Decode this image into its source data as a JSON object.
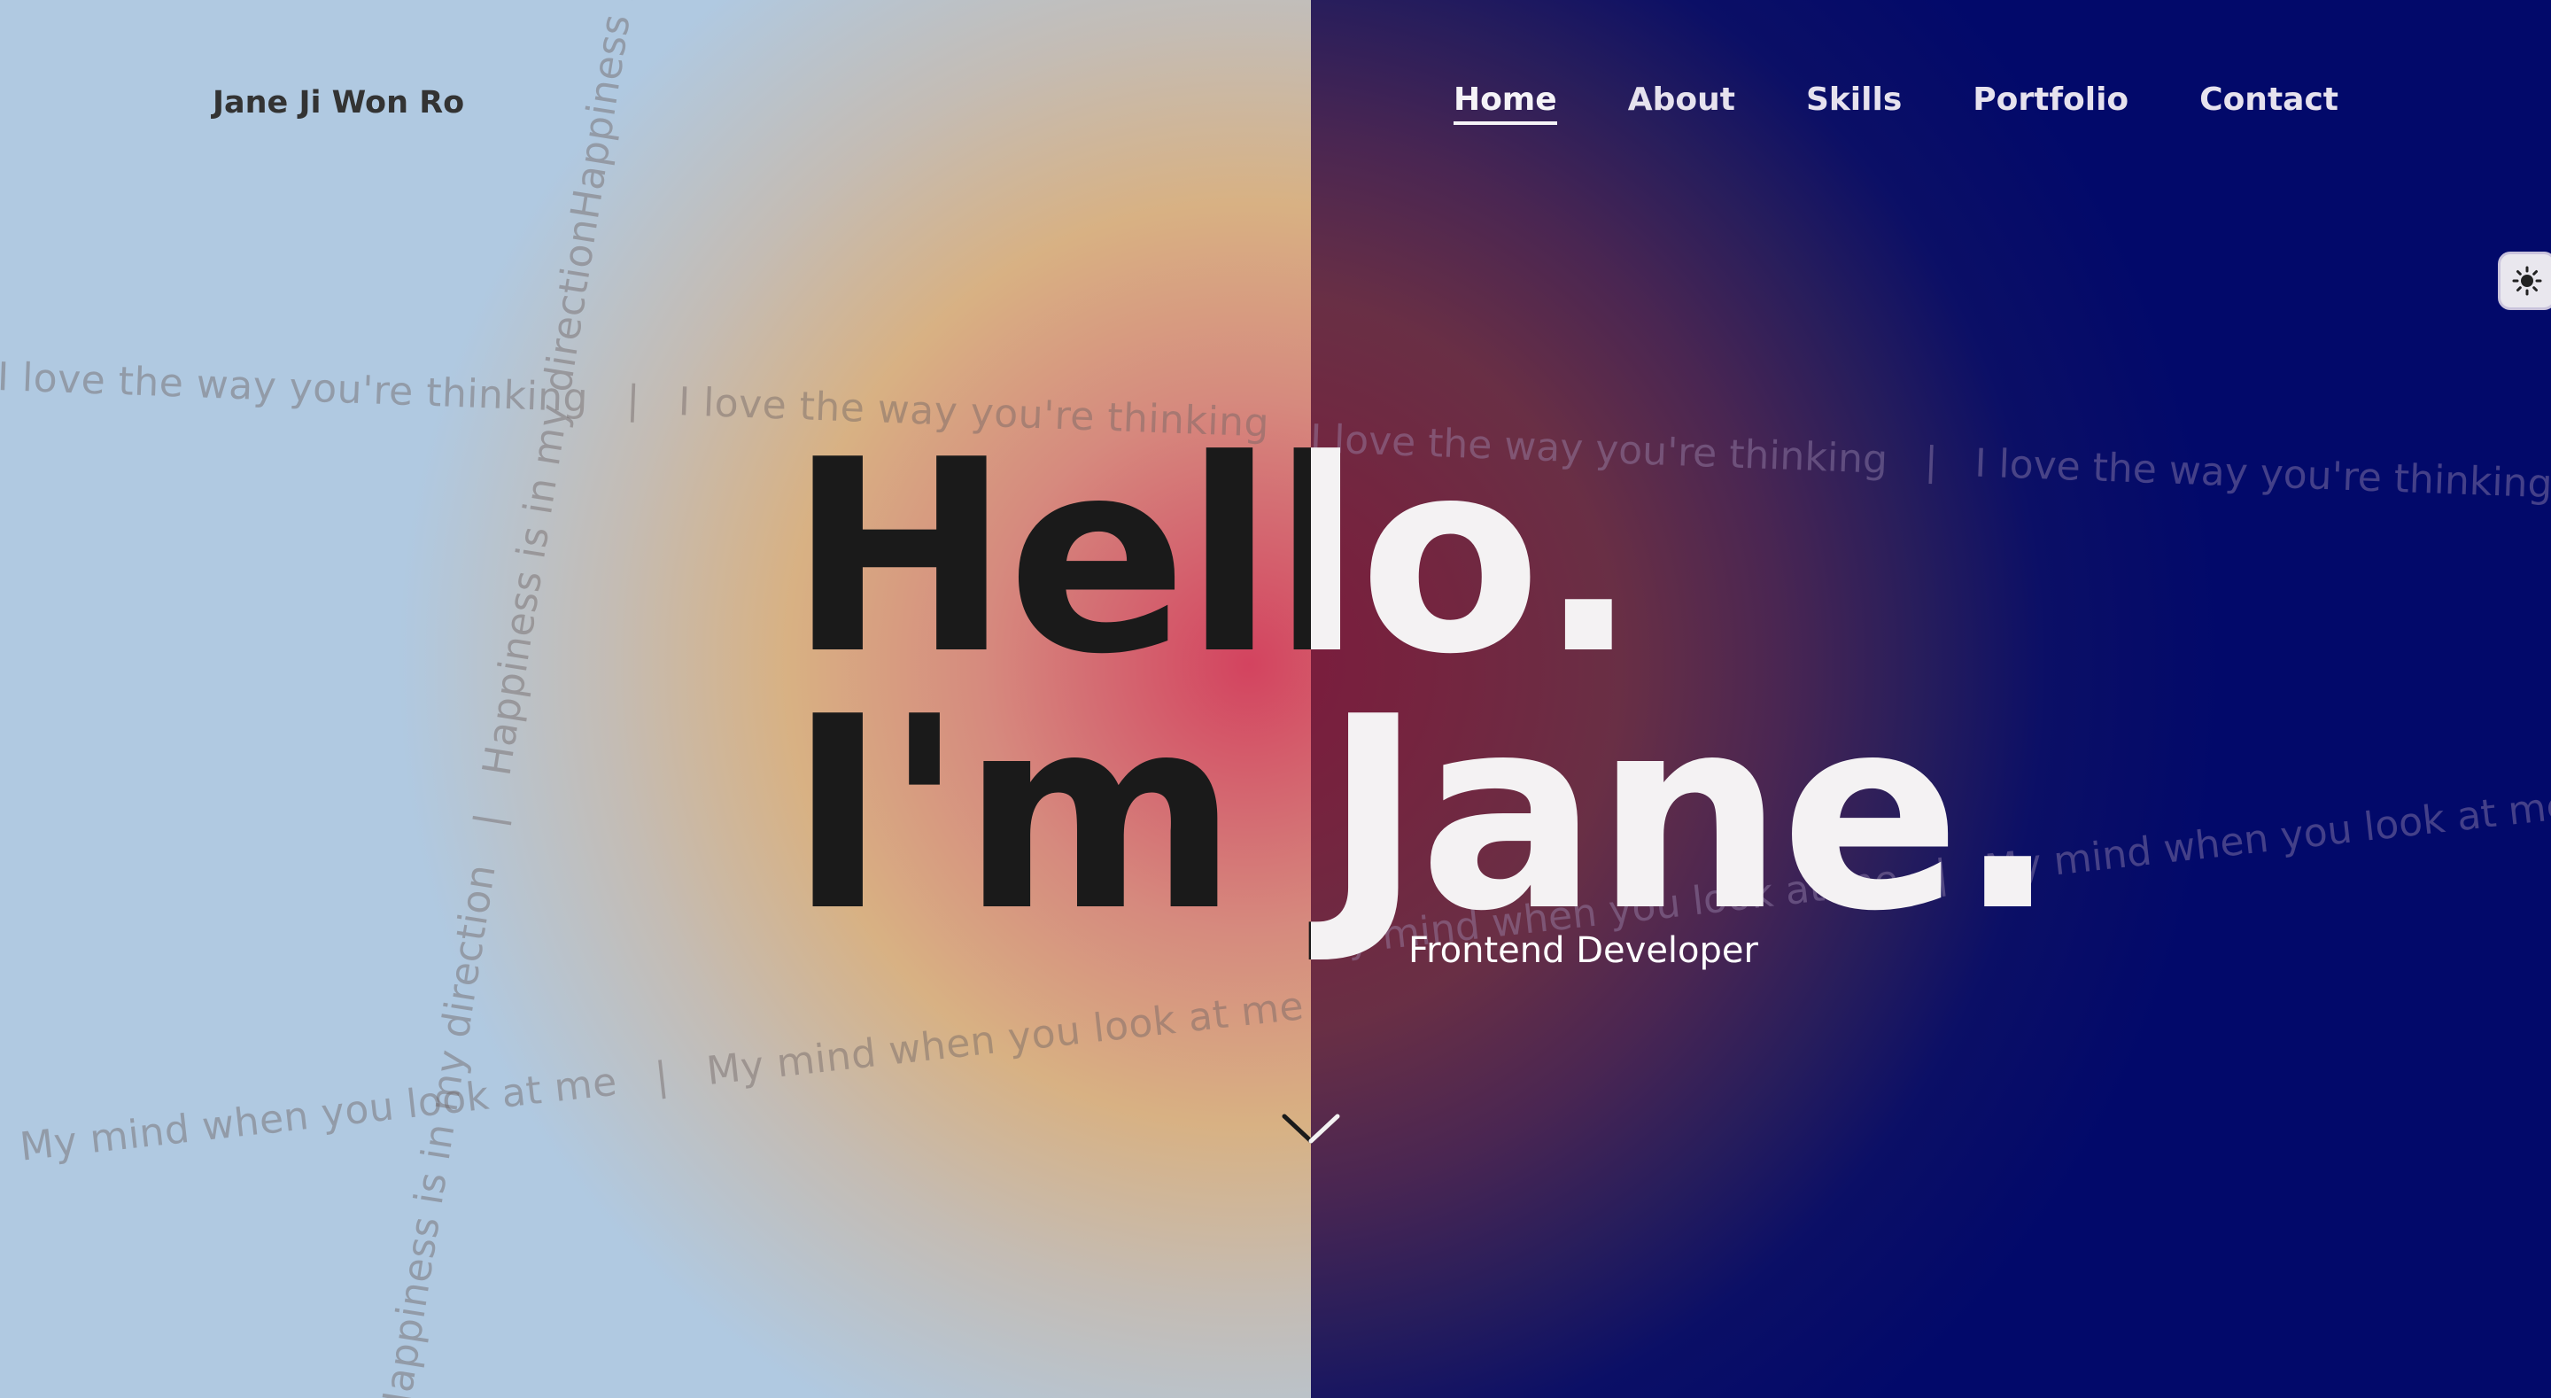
{
  "header": {
    "logo": "Jane Ji Won Ro"
  },
  "nav": {
    "items": [
      {
        "label": "Home",
        "active": true
      },
      {
        "label": "About",
        "active": false
      },
      {
        "label": "Skills",
        "active": false
      },
      {
        "label": "Portfolio",
        "active": false
      },
      {
        "label": "Contact",
        "active": false
      }
    ]
  },
  "theme_toggle": {
    "icon": "sun-icon"
  },
  "hero": {
    "line1": "Hello.",
    "line2": "I'm Jane.",
    "subtitle": "Frontend Developer",
    "scroll_icon": "chevron-down-icon"
  },
  "marquees": {
    "phrase_1": "I love the way you're thinking",
    "phrase_2": "My mind when you look at me",
    "phrase_3": "Happiness is in my direction",
    "separator": "|"
  },
  "colors": {
    "light_bg": "#b0c9e1",
    "warm_center": "#d3435f",
    "dark_bg": "#02096a",
    "text_dark": "#1a1a1a",
    "text_light": "#f4f2f3"
  }
}
